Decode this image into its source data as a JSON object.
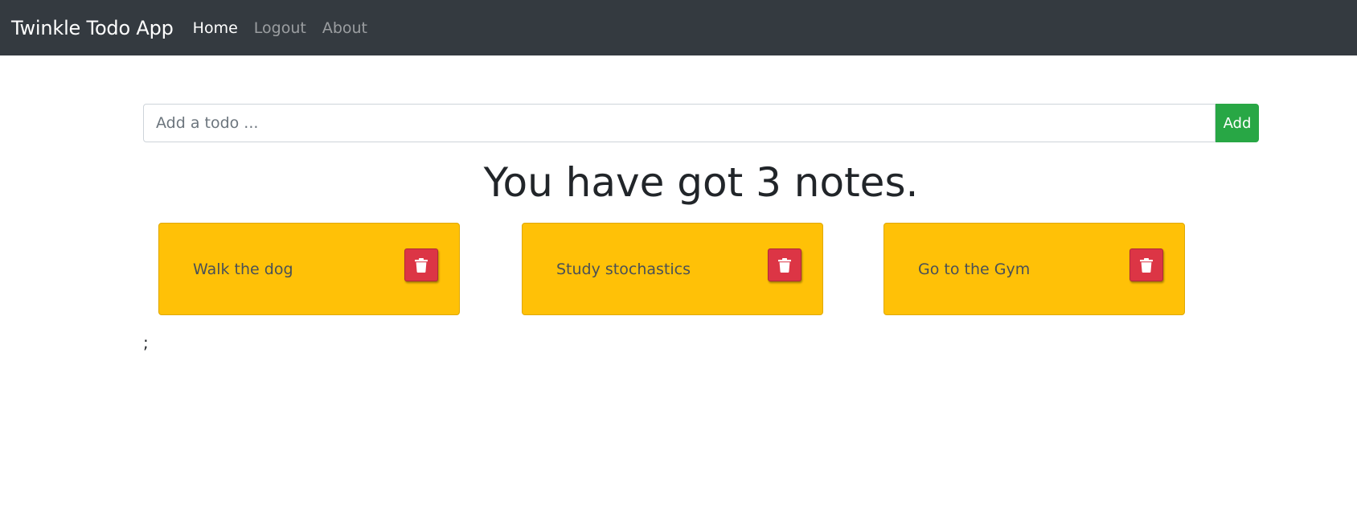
{
  "navbar": {
    "brand": "Twinkle Todo App",
    "links": [
      {
        "label": "Home",
        "active": true
      },
      {
        "label": "Logout",
        "active": false
      },
      {
        "label": "About",
        "active": false
      }
    ]
  },
  "todo_form": {
    "input_placeholder": "Add a todo ...",
    "input_value": "",
    "add_label": "Add"
  },
  "heading": "You have got 3 notes.",
  "todos": [
    {
      "text": "Walk the dog"
    },
    {
      "text": "Study stochastics"
    },
    {
      "text": "Go to the Gym"
    }
  ],
  "trailing_text": ";",
  "colors": {
    "navbar_bg": "#343a40",
    "add_button": "#28a745",
    "card_bg": "#ffc107",
    "delete_button": "#dc3545"
  },
  "icons": {
    "delete_icon": "trash-icon"
  }
}
